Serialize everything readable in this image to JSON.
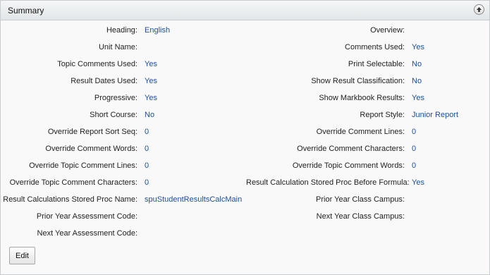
{
  "panel": {
    "title": "Summary"
  },
  "left_fields": [
    {
      "label": "Heading:",
      "value": "English"
    },
    {
      "label": "Unit Name:",
      "value": ""
    },
    {
      "label": "Topic Comments Used:",
      "value": "Yes"
    },
    {
      "label": "Result Dates Used:",
      "value": "Yes"
    },
    {
      "label": "Progressive:",
      "value": "Yes"
    },
    {
      "label": "Short Course:",
      "value": "No"
    },
    {
      "label": "Override Report Sort Seq:",
      "value": "0"
    },
    {
      "label": "Override Comment Words:",
      "value": "0"
    },
    {
      "label": "Override Topic Comment Lines:",
      "value": "0"
    },
    {
      "label": "Override Topic Comment Characters:",
      "value": "0"
    },
    {
      "label": "Result Calculations Stored Proc Name:",
      "value": "spuStudentResultsCalcMain"
    },
    {
      "label": "Prior Year Assessment Code:",
      "value": ""
    },
    {
      "label": "Next Year Assessment Code:",
      "value": ""
    }
  ],
  "right_fields": [
    {
      "label": "Overview:",
      "value": ""
    },
    {
      "label": "Comments Used:",
      "value": "Yes"
    },
    {
      "label": "Print Selectable:",
      "value": "No"
    },
    {
      "label": "Show Result Classification:",
      "value": "No"
    },
    {
      "label": "Show Markbook Results:",
      "value": "Yes"
    },
    {
      "label": "Report Style:",
      "value": "Junior Report"
    },
    {
      "label": "Override Comment Lines:",
      "value": "0"
    },
    {
      "label": "Override Comment Characters:",
      "value": "0"
    },
    {
      "label": "Override Topic Comment Words:",
      "value": "0"
    },
    {
      "label": "Result Calculation Stored Proc Before Formula:",
      "value": "Yes"
    },
    {
      "label": "Prior Year Class Campus:",
      "value": ""
    },
    {
      "label": "Next Year Class Campus:",
      "value": ""
    }
  ],
  "actions": {
    "edit_label": "Edit"
  }
}
